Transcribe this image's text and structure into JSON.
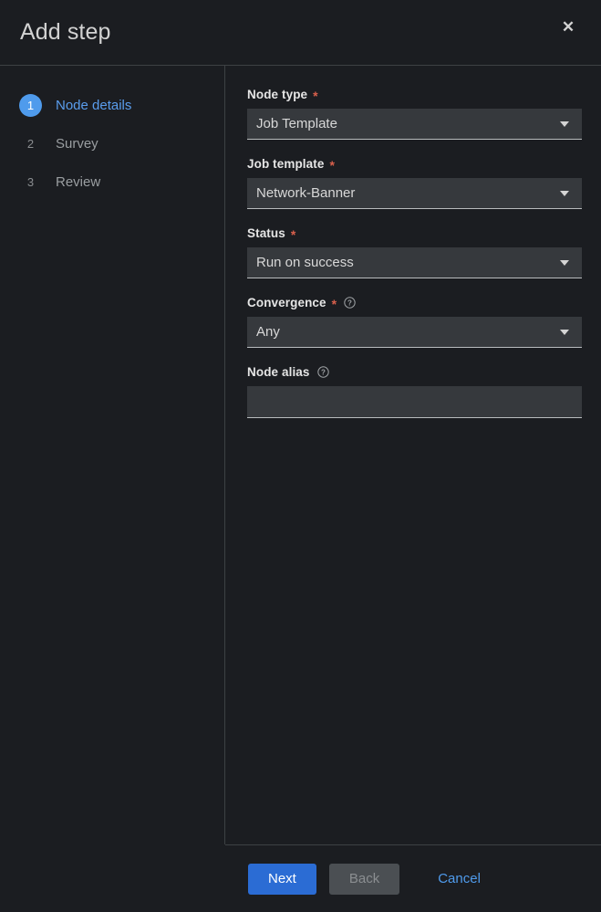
{
  "header": {
    "title": "Add step",
    "close_label": "✕",
    "close_icon": "close-icon"
  },
  "sidebar": {
    "steps": [
      {
        "number": "1",
        "label": "Node details",
        "active": true
      },
      {
        "number": "2",
        "label": "Survey",
        "active": false
      },
      {
        "number": "3",
        "label": "Review",
        "active": false
      }
    ]
  },
  "form": {
    "fields": [
      {
        "label": "Node type",
        "required": true,
        "help": false,
        "type": "select",
        "value": "Job Template",
        "icon": "chevron-down-icon"
      },
      {
        "label": "Job template",
        "required": true,
        "help": false,
        "type": "select",
        "value": "Network-Banner",
        "icon": "chevron-down-icon"
      },
      {
        "label": "Status",
        "required": true,
        "help": false,
        "type": "select",
        "value": "Run on success",
        "icon": "chevron-down-icon"
      },
      {
        "label": "Convergence",
        "required": true,
        "help": true,
        "type": "select",
        "value": "Any",
        "icon": "chevron-down-icon"
      },
      {
        "label": "Node alias",
        "required": false,
        "help": true,
        "type": "text",
        "value": "",
        "placeholder": ""
      }
    ],
    "required_marker": "*",
    "help_icon": "help-circle-icon"
  },
  "footer": {
    "next_label": "Next",
    "back_label": "Back",
    "back_disabled": true,
    "cancel_label": "Cancel"
  },
  "colors": {
    "accent_blue": "#2b6cd4",
    "link_blue": "#4f9bec",
    "required_red": "#d9604c",
    "background": "#1b1d21",
    "field_background": "#36393d",
    "divider": "#3d4144"
  }
}
